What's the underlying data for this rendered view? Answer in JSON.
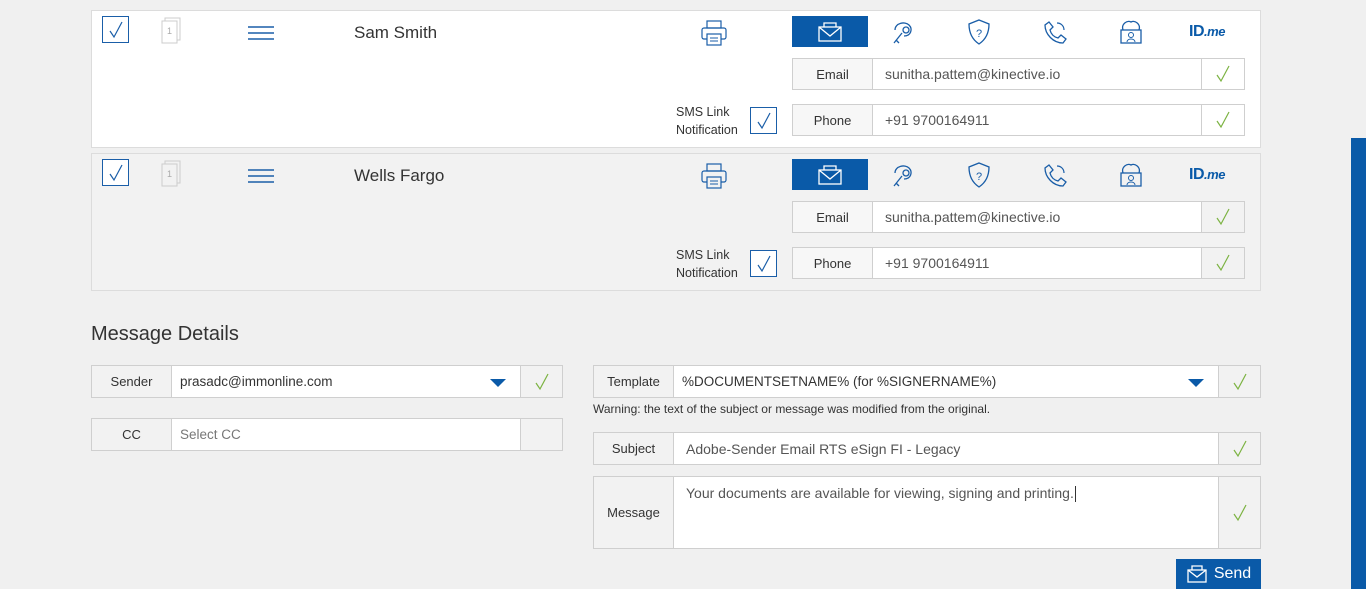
{
  "signers": [
    {
      "name": "Sam Smith",
      "doc_page": "1",
      "email_label": "Email",
      "email_value": "sunitha.pattem@kinective.io",
      "phone_label": "Phone",
      "phone_value": "+91 9700164911",
      "sms_line1": "SMS Link",
      "sms_line2": "Notification"
    },
    {
      "name": "Wells Fargo",
      "doc_page": "1",
      "email_label": "Email",
      "email_value": "sunitha.pattem@kinective.io",
      "phone_label": "Phone",
      "phone_value": "+91 9700164911",
      "sms_line1": "SMS Link",
      "sms_line2": "Notification"
    }
  ],
  "auth_methods": [
    "email-icon",
    "key-icon",
    "shield-question-icon",
    "phone-icon",
    "id-card-icon",
    "idme-logo"
  ],
  "idme": {
    "main": "ID",
    "suffix": ".me"
  },
  "message_details": {
    "title": "Message Details",
    "sender_label": "Sender",
    "sender_value": "prasadc@immonline.com",
    "cc_label": "CC",
    "cc_placeholder": "Select CC",
    "template_label": "Template",
    "template_value": "%DOCUMENTSETNAME% (for %SIGNERNAME%)",
    "warning": "Warning: the text of the subject or message was modified from the original.",
    "subject_label": "Subject",
    "subject_value": "Adobe-Sender Email RTS eSign FI - Legacy",
    "message_label": "Message",
    "message_value": "Your documents are available for viewing, signing and printing.",
    "send_label": "Send"
  },
  "colors": {
    "accent": "#0a5aa8",
    "check_green": "#7cb342",
    "background": "#f0f0f0"
  }
}
